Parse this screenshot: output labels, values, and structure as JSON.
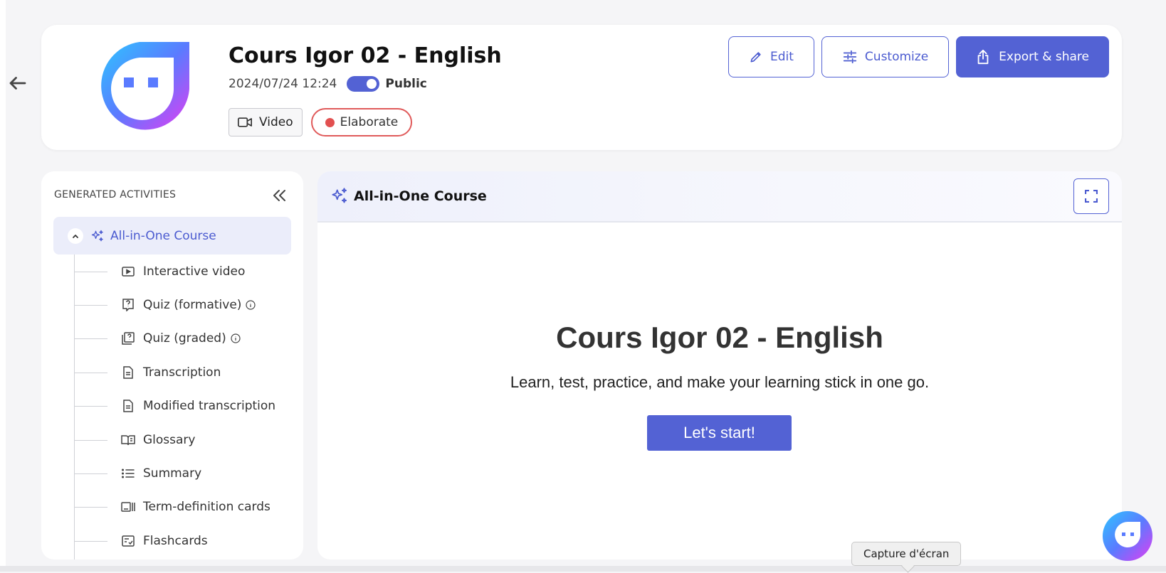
{
  "header": {
    "title": "Cours Igor 02 - English",
    "datetime": "2024/07/24 12:24",
    "visibility_label": "Public",
    "visibility_on": true,
    "tags": {
      "video": "Video",
      "level": "Elaborate"
    }
  },
  "actions": {
    "edit": "Edit",
    "customize": "Customize",
    "export": "Export & share"
  },
  "sidebar": {
    "heading": "GENERATED ACTIVITIES",
    "active_item": "All-in-One Course",
    "items": [
      {
        "label": "Interactive video",
        "icon": "play-video-icon"
      },
      {
        "label": "Quiz (formative)",
        "icon": "quiz-icon",
        "info": true
      },
      {
        "label": "Quiz (graded)",
        "icon": "quiz-graded-icon",
        "info": true
      },
      {
        "label": "Transcription",
        "icon": "document-icon"
      },
      {
        "label": "Modified transcription",
        "icon": "document-icon"
      },
      {
        "label": "Glossary",
        "icon": "book-icon"
      },
      {
        "label": "Summary",
        "icon": "list-icon"
      },
      {
        "label": "Term-definition cards",
        "icon": "cards-icon"
      },
      {
        "label": "Flashcards",
        "icon": "flashcard-icon"
      }
    ]
  },
  "main": {
    "panel_title": "All-in-One Course",
    "hero_title": "Cours Igor 02 - English",
    "hero_subtitle": "Learn, test, practice, and make your learning stick in one go.",
    "start_button": "Let's start!"
  },
  "tooltip": "Capture d'écran",
  "colors": {
    "accent": "#5362d4",
    "danger": "#e25050",
    "page_bg": "#f5f5f7"
  }
}
